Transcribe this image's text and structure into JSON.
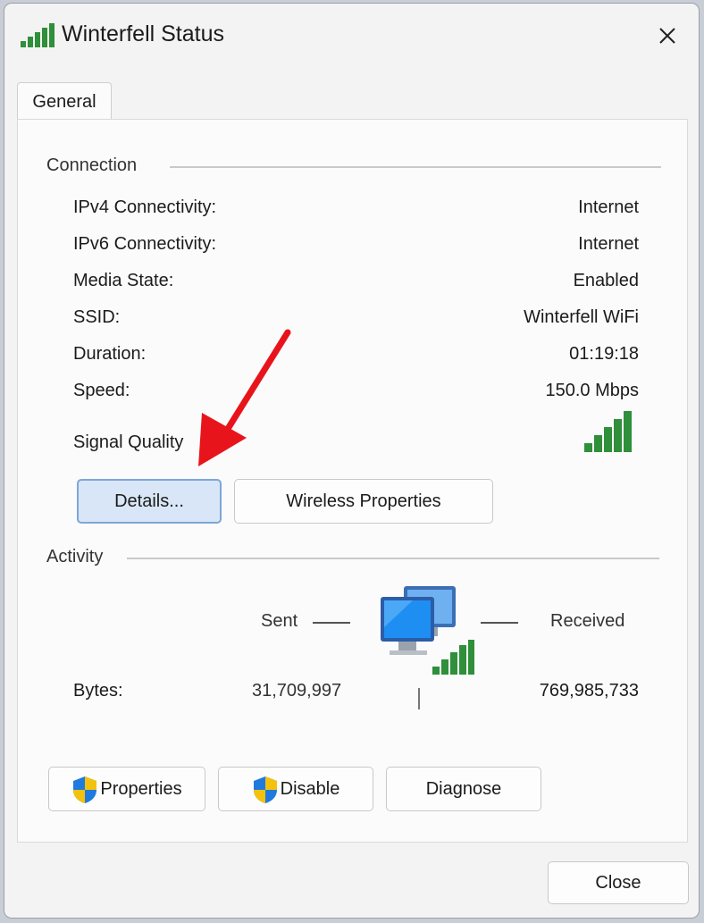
{
  "window": {
    "title": "Winterfell Status",
    "close_icon": "close-icon"
  },
  "tabs": [
    {
      "label": "General",
      "selected": true
    }
  ],
  "connection": {
    "heading": "Connection",
    "rows": [
      {
        "label": "IPv4 Connectivity:",
        "value": "Internet"
      },
      {
        "label": "IPv6 Connectivity:",
        "value": "Internet"
      },
      {
        "label": "Media State:",
        "value": "Enabled"
      },
      {
        "label": "SSID:",
        "value": "Winterfell WiFi"
      },
      {
        "label": "Duration:",
        "value": "01:19:18"
      },
      {
        "label": "Speed:",
        "value": "150.0 Mbps"
      }
    ],
    "signal_label": "Signal Quality",
    "signal_bars": 5,
    "signal_max": 5,
    "details_button": "Details...",
    "wireless_button": "Wireless Properties"
  },
  "activity": {
    "heading": "Activity",
    "sent_label": "Sent",
    "received_label": "Received",
    "bytes_label": "Bytes:",
    "bytes_sent": "31,709,997",
    "bytes_received": "769,985,733"
  },
  "buttons": {
    "properties": "Properties",
    "disable": "Disable",
    "diagnose": "Diagnose",
    "close": "Close"
  },
  "colors": {
    "signal": "#2f8f3a",
    "annotation_arrow": "#e8141b",
    "focus": "#7ea6d8"
  }
}
